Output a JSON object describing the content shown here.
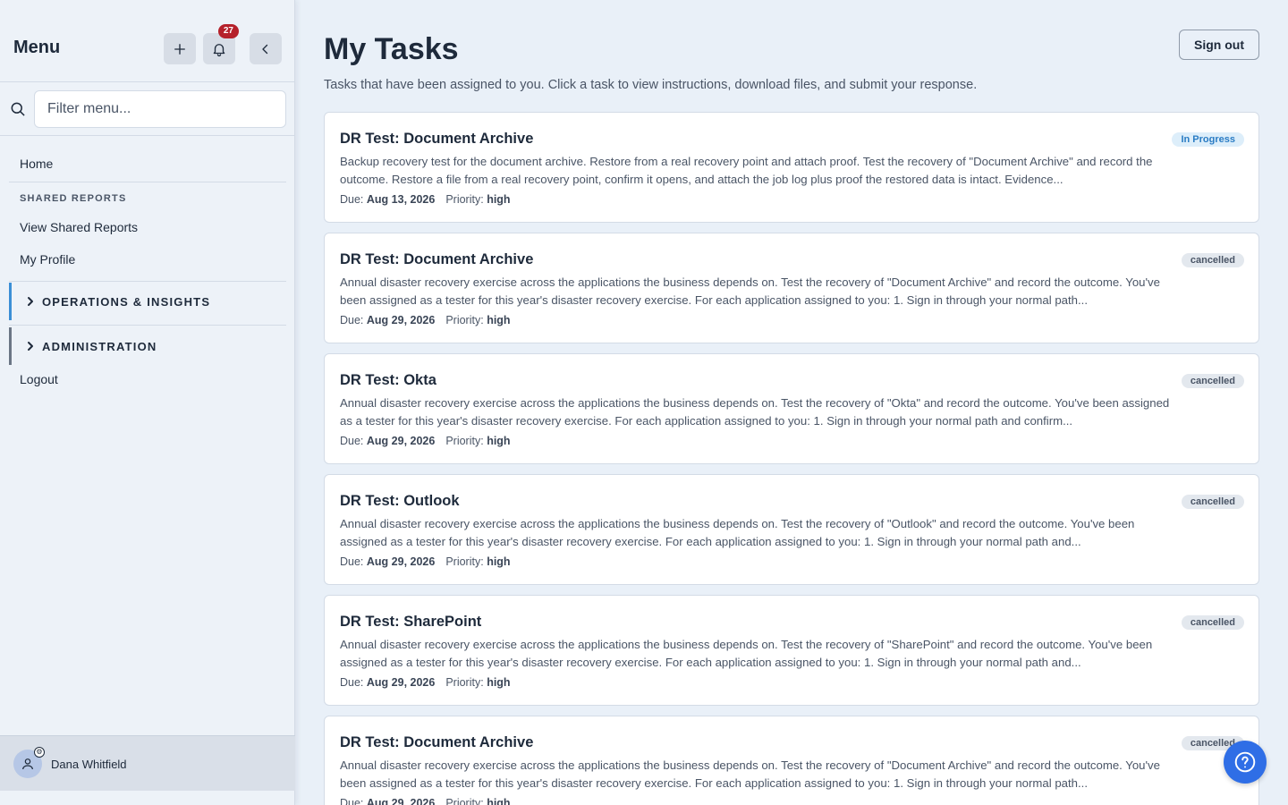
{
  "sidebar": {
    "title": "Menu",
    "notification_count": "27",
    "filter_placeholder": "Filter menu...",
    "home_label": "Home",
    "section_shared_reports": "SHARED REPORTS",
    "view_shared_reports": "View Shared Reports",
    "my_profile": "My Profile",
    "group_operations": "OPERATIONS & INSIGHTS",
    "group_administration": "ADMINISTRATION",
    "logout": "Logout",
    "user_name": "Dana Whitfield",
    "colors": {
      "operations_bar": "#3b8fd6",
      "administration_bar": "#6b7685"
    }
  },
  "header": {
    "title": "My Tasks",
    "subtitle": "Tasks that have been assigned to you. Click a task to view instructions, download files, and submit your response.",
    "sign_out": "Sign out"
  },
  "tasks": [
    {
      "title": "DR Test: Document Archive",
      "description": "Backup recovery test for the document archive. Restore from a real recovery point and attach proof. Test the recovery of \"Document Archive\" and record the outcome. Restore a file from a real recovery point, confirm it opens, and attach the job log plus proof the restored data is intact. Evidence...",
      "due_label": "Due:",
      "due": "Aug 13, 2026",
      "priority_label": "Priority:",
      "priority": "high",
      "status": "In Progress"
    },
    {
      "title": "DR Test: Document Archive",
      "description": "Annual disaster recovery exercise across the applications the business depends on. Test the recovery of \"Document Archive\" and record the outcome. You've been assigned as a tester for this year's disaster recovery exercise. For each application assigned to you: 1. Sign in through your normal path...",
      "due_label": "Due:",
      "due": "Aug 29, 2026",
      "priority_label": "Priority:",
      "priority": "high",
      "status": "cancelled"
    },
    {
      "title": "DR Test: Okta",
      "description": "Annual disaster recovery exercise across the applications the business depends on. Test the recovery of \"Okta\" and record the outcome. You've been assigned as a tester for this year's disaster recovery exercise. For each application assigned to you: 1. Sign in through your normal path and confirm...",
      "due_label": "Due:",
      "due": "Aug 29, 2026",
      "priority_label": "Priority:",
      "priority": "high",
      "status": "cancelled"
    },
    {
      "title": "DR Test: Outlook",
      "description": "Annual disaster recovery exercise across the applications the business depends on. Test the recovery of \"Outlook\" and record the outcome. You've been assigned as a tester for this year's disaster recovery exercise. For each application assigned to you: 1. Sign in through your normal path and...",
      "due_label": "Due:",
      "due": "Aug 29, 2026",
      "priority_label": "Priority:",
      "priority": "high",
      "status": "cancelled"
    },
    {
      "title": "DR Test: SharePoint",
      "description": "Annual disaster recovery exercise across the applications the business depends on. Test the recovery of \"SharePoint\" and record the outcome. You've been assigned as a tester for this year's disaster recovery exercise. For each application assigned to you: 1. Sign in through your normal path and...",
      "due_label": "Due:",
      "due": "Aug 29, 2026",
      "priority_label": "Priority:",
      "priority": "high",
      "status": "cancelled"
    },
    {
      "title": "DR Test: Document Archive",
      "description": "Annual disaster recovery exercise across the applications the business depends on. Test the recovery of \"Document Archive\" and record the outcome. You've been assigned as a tester for this year's disaster recovery exercise. For each application assigned to you: 1. Sign in through your normal path...",
      "due_label": "Due:",
      "due": "Aug 29, 2026",
      "priority_label": "Priority:",
      "priority": "high",
      "status": "cancelled"
    }
  ],
  "icons": {
    "add": "plus-icon",
    "notifications": "bell-icon",
    "collapse": "chevron-left-icon",
    "filter": "search-icon",
    "group_toggle": "chevron-right-icon",
    "user": "user-icon",
    "help": "question-circle-icon"
  }
}
